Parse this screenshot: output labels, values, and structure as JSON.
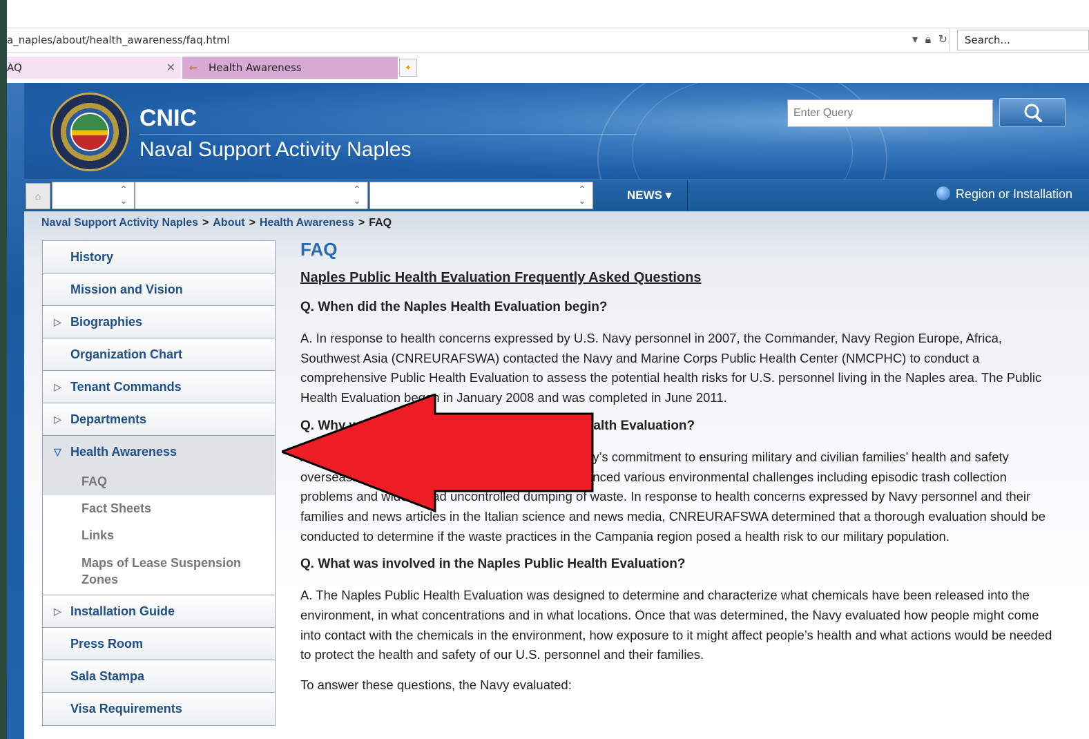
{
  "browser": {
    "address": "a_naples/about/health_awareness/faq.html",
    "search_placeholder": "Search...",
    "tabs": [
      {
        "label": "AQ"
      },
      {
        "label": "Health Awareness"
      }
    ]
  },
  "header": {
    "title": "CNIC",
    "subtitle": "Naval Support Activity Naples",
    "query_placeholder": "Enter Query"
  },
  "navbar": {
    "news_label": "NEWS ▾",
    "region_label": "Region or Installation"
  },
  "breadcrumb": {
    "items": [
      "Naval Support Activity Naples",
      "About",
      "Health Awareness"
    ],
    "current": "FAQ",
    "sep": ">"
  },
  "sidebar": {
    "items": [
      {
        "label": "History",
        "expandable": false
      },
      {
        "label": "Mission and Vision",
        "expandable": false
      },
      {
        "label": "Biographies",
        "expandable": true
      },
      {
        "label": "Organization Chart",
        "expandable": false
      },
      {
        "label": "Tenant Commands",
        "expandable": true
      },
      {
        "label": "Departments",
        "expandable": true
      },
      {
        "label": "Health Awareness",
        "expandable": true,
        "active": true
      },
      {
        "label": "Installation Guide",
        "expandable": true
      },
      {
        "label": "Press Room",
        "expandable": false
      },
      {
        "label": "Sala Stampa",
        "expandable": false
      },
      {
        "label": "Visa Requirements",
        "expandable": false
      }
    ],
    "subitems": [
      {
        "label": "FAQ",
        "active": true
      },
      {
        "label": "Fact Sheets"
      },
      {
        "label": "Links"
      },
      {
        "label": "Maps of Lease Suspension Zones"
      }
    ]
  },
  "main": {
    "title": "FAQ",
    "heading": "Naples Public Health Evaluation Frequently Asked Questions",
    "q1": "Q.  When did the Naples Health Evaluation begin?",
    "a1": "A.  In response to health concerns expressed by U.S. Navy personnel in 2007, the Commander, Navy Region Europe, Africa, Southwest Asia (CNREURAFSWA) contacted the Navy and Marine Corps Public Health Center (NMCPHC) to conduct a comprehensive Public Health Evaluation to assess the potential health risks for U.S. personnel living in the Naples area. The Public Health Evaluation began in January 2008 and was completed in June 2011.",
    "q2": "Q.  Why was the Navy conducting the Public Health Evaluation?",
    "a2": "A.  The evaluation was conducted as part of the Navy’s commitment to ensuring military and civilian families’ health and safety overseas.  The Campania region of Italy has experienced various environmental challenges including episodic trash collection problems and widespread uncontrolled dumping of waste.  In response to health concerns expressed by Navy personnel and their families and news articles in the Italian science and news media, CNREURAFSWA determined that a thorough evaluation should be conducted to determine if the waste practices in the Campania region posed a health risk to our military population.",
    "q3": "Q. What was involved in the Naples Public Health Evaluation?",
    "a3": "A.  The Naples Public Health Evaluation was designed to determine and characterize what chemicals have been released into the environment, in what concentrations and in what locations.  Once that was determined, the Navy evaluated how people might come into contact with the chemicals in the environment, how exposure to it might affect people’s health and what actions would be needed to protect the health and safety of our U.S. personnel and their families.",
    "p4": "To answer these questions, the Navy evaluated:"
  },
  "colors": {
    "accent": "#1f4f8a",
    "heading": "#2a6ab0",
    "arrow": "#ee1c24"
  }
}
